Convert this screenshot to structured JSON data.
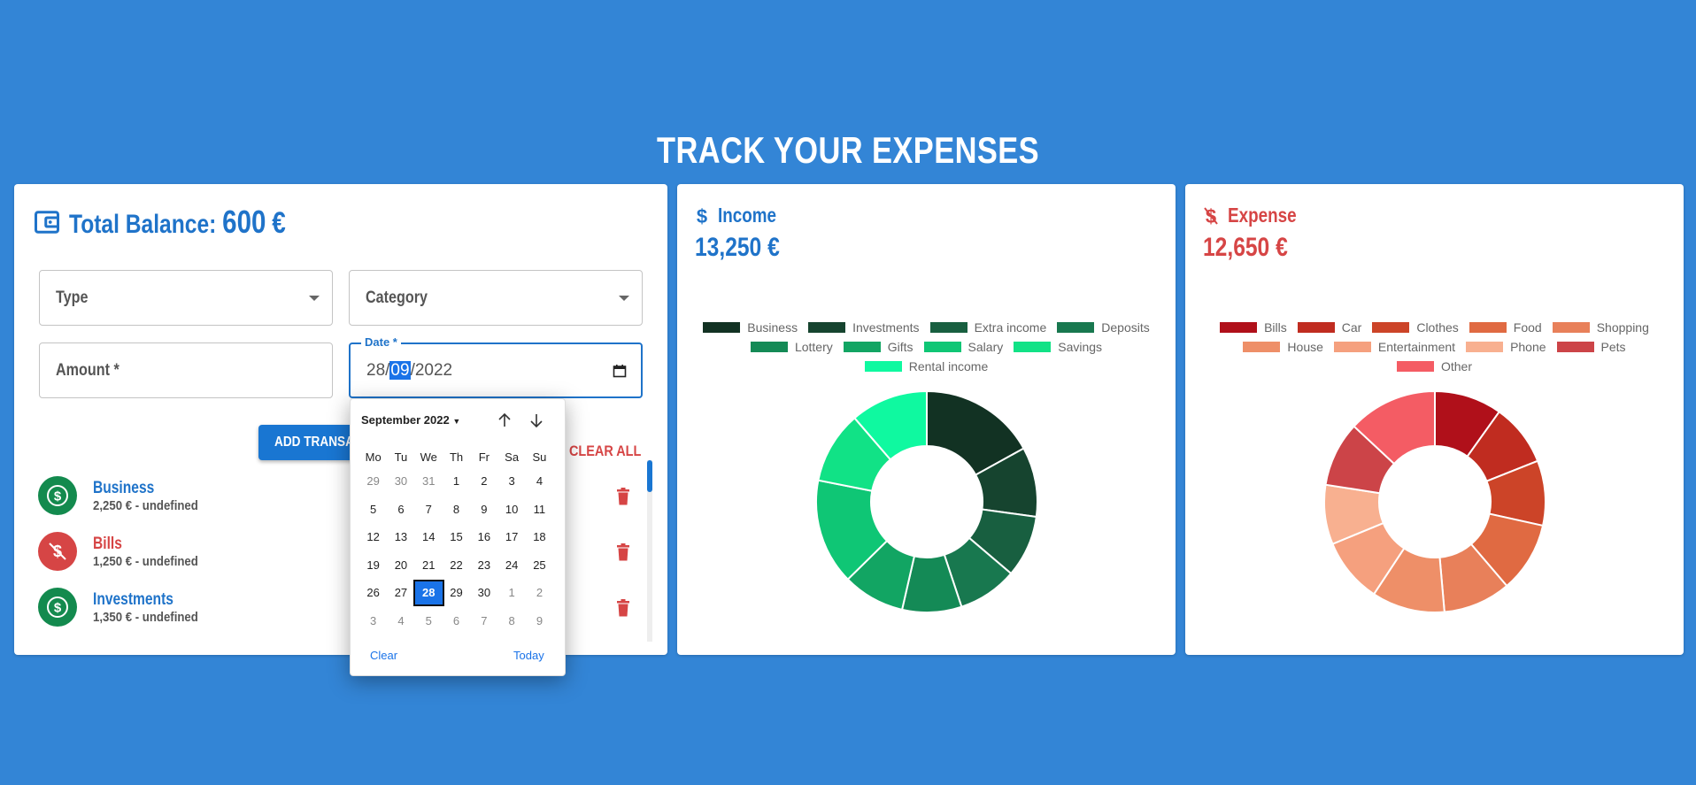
{
  "title": "TRACK YOUR EXPENSES",
  "balance": {
    "label": "Total Balance:",
    "amount": "600",
    "currency": "€",
    "icon": "wallet-icon"
  },
  "form": {
    "type_placeholder": "Type",
    "category_placeholder": "Category",
    "amount_placeholder": "Amount *",
    "date_label": "Date *",
    "date_day": "28/",
    "date_month": "09",
    "date_year": "/2022",
    "add_button": "ADD TRANSACTION",
    "clear_all": "CLEAR ALL"
  },
  "transactions": [
    {
      "name": "Business",
      "detail": "2,250 € - undefined",
      "kind": "income"
    },
    {
      "name": "Bills",
      "detail": "1,250 € - undefined",
      "kind": "expense"
    },
    {
      "name": "Investments",
      "detail": "1,350 € - undefined",
      "kind": "income"
    }
  ],
  "datepicker": {
    "month_label": "September 2022",
    "weekdays": [
      "Mo",
      "Tu",
      "We",
      "Th",
      "Fr",
      "Sa",
      "Su"
    ],
    "weeks": [
      [
        "29",
        "30",
        "31",
        "1",
        "2",
        "3",
        "4"
      ],
      [
        "5",
        "6",
        "7",
        "8",
        "9",
        "10",
        "11"
      ],
      [
        "12",
        "13",
        "14",
        "15",
        "16",
        "17",
        "18"
      ],
      [
        "19",
        "20",
        "21",
        "22",
        "23",
        "24",
        "25"
      ],
      [
        "26",
        "27",
        "28",
        "29",
        "30",
        "1",
        "2"
      ],
      [
        "3",
        "4",
        "5",
        "6",
        "7",
        "8",
        "9"
      ]
    ],
    "selected": "28",
    "clear": "Clear",
    "today": "Today"
  },
  "income": {
    "title": "Income",
    "amount": "13,250 €",
    "color": "#1f73c9",
    "legend": [
      "Business",
      "Investments",
      "Extra income",
      "Deposits",
      "Lottery",
      "Gifts",
      "Salary",
      "Savings",
      "Rental income"
    ],
    "colors": [
      "#123223",
      "#16442f",
      "#185f40",
      "#18784f",
      "#148a56",
      "#12a563",
      "#0fc675",
      "#11e286",
      "#0ff9a0"
    ]
  },
  "expense": {
    "title": "Expense",
    "amount": "12,650 €",
    "color": "#d64545",
    "legend": [
      "Bills",
      "Car",
      "Clothes",
      "Food",
      "Shopping",
      "House",
      "Entertainment",
      "Phone",
      "Pets",
      "Other"
    ],
    "colors": [
      "#b0101a",
      "#c02c20",
      "#cc4428",
      "#e06a42",
      "#e8805a",
      "#ee8f68",
      "#f5a07e",
      "#f8b090",
      "#cc4448",
      "#f45c64"
    ]
  },
  "chart_data": [
    {
      "type": "pie",
      "title": "Income",
      "categories": [
        "Business",
        "Investments",
        "Extra income",
        "Deposits",
        "Lottery",
        "Gifts",
        "Salary",
        "Savings",
        "Rental income"
      ],
      "values": [
        2250,
        1350,
        1200,
        1150,
        1150,
        1200,
        2050,
        1400,
        1500
      ]
    },
    {
      "type": "pie",
      "title": "Expense",
      "categories": [
        "Bills",
        "Car",
        "Clothes",
        "Food",
        "Shopping",
        "House",
        "Entertainment",
        "Phone",
        "Pets",
        "Other"
      ],
      "values": [
        1250,
        1150,
        1200,
        1300,
        1250,
        1350,
        1200,
        1100,
        1200,
        1650
      ]
    }
  ]
}
